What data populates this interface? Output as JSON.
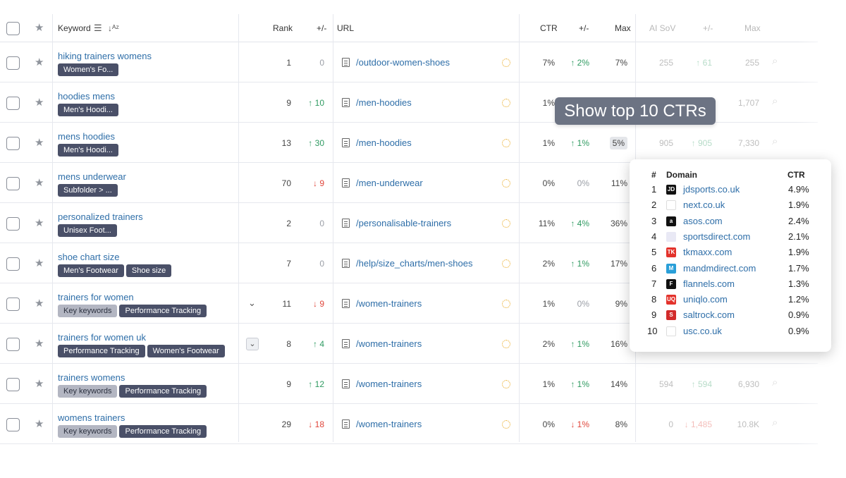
{
  "header": {
    "keyword": "Keyword",
    "rank": "Rank",
    "rank_delta": "+/-",
    "url": "URL",
    "ctr": "CTR",
    "ctr_delta": "+/-",
    "max": "Max",
    "ai_sov": "AI SoV",
    "ai_delta": "+/-",
    "ai_max": "Max"
  },
  "rows": [
    {
      "keyword": "hiking trainers womens",
      "tags": [
        {
          "t": "Women's Fo...",
          "s": "dark"
        }
      ],
      "rank": "1",
      "rank_delta": "0",
      "rank_dir": "zero",
      "url": "/outdoor-women-shoes",
      "ctr": "7%",
      "ctr_delta": "2%",
      "ctr_dir": "up",
      "max": "7%",
      "ai": "255",
      "ai_delta": "61",
      "ai_max": "255"
    },
    {
      "keyword": "hoodies mens",
      "tags": [
        {
          "t": "Men's Hoodi...",
          "s": "dark"
        }
      ],
      "rank": "9",
      "rank_delta": "10",
      "rank_dir": "up",
      "url": "/men-hoodies",
      "ctr": "1%",
      "ctr_delta": "",
      "ctr_dir": "none",
      "max": "",
      "ai": "",
      "ai_delta": "",
      "ai_max": "1,707"
    },
    {
      "keyword": "mens hoodies",
      "tags": [
        {
          "t": "Men's Hoodi...",
          "s": "dark"
        }
      ],
      "rank": "13",
      "rank_delta": "30",
      "rank_dir": "up",
      "url": "/men-hoodies",
      "ctr": "1%",
      "ctr_delta": "1%",
      "ctr_dir": "up",
      "max": "5%",
      "ai": "905",
      "ai_delta": "905",
      "ai_max": "7,330"
    },
    {
      "keyword": "mens underwear",
      "tags": [
        {
          "t": "Subfolder > ...",
          "s": "dark"
        }
      ],
      "rank": "70",
      "rank_delta": "9",
      "rank_dir": "down",
      "url": "/men-underwear",
      "ctr": "0%",
      "ctr_delta": "0%",
      "ctr_dir": "zero",
      "max": "11%",
      "ai": "",
      "ai_delta": "",
      "ai_max": ""
    },
    {
      "keyword": "personalized trainers",
      "tags": [
        {
          "t": "Unisex Foot...",
          "s": "dark"
        }
      ],
      "rank": "2",
      "rank_delta": "0",
      "rank_dir": "zero",
      "url": "/personalisable-trainers",
      "ctr": "11%",
      "ctr_delta": "4%",
      "ctr_dir": "up",
      "max": "36%",
      "ai": "",
      "ai_delta": "",
      "ai_max": ""
    },
    {
      "keyword": "shoe chart size",
      "tags": [
        {
          "t": "Men's Footwear",
          "s": "dark"
        },
        {
          "t": "Shoe size",
          "s": "dark"
        }
      ],
      "rank": "7",
      "rank_delta": "0",
      "rank_dir": "zero",
      "url": "/help/size_charts/men-shoes",
      "ctr": "2%",
      "ctr_delta": "1%",
      "ctr_dir": "up",
      "max": "17%",
      "ai": "",
      "ai_delta": "",
      "ai_max": ""
    },
    {
      "keyword": "trainers for women",
      "tags": [
        {
          "t": "Key keywords",
          "s": "light"
        },
        {
          "t": "Performance Tracking",
          "s": "dark"
        }
      ],
      "rank": "11",
      "rank_delta": "9",
      "rank_dir": "down",
      "url": "/women-trainers",
      "ctr": "1%",
      "ctr_delta": "0%",
      "ctr_dir": "zero",
      "max": "9%",
      "ai": "",
      "ai_delta": "",
      "ai_max": ""
    },
    {
      "keyword": "trainers for women uk",
      "tags": [
        {
          "t": "Performance Tracking",
          "s": "dark"
        },
        {
          "t": "Women's Footwear",
          "s": "dark"
        }
      ],
      "rank": "8",
      "rank_delta": "4",
      "rank_dir": "up",
      "url": "/women-trainers",
      "ctr": "2%",
      "ctr_delta": "1%",
      "ctr_dir": "up",
      "max": "16%",
      "ai": "",
      "ai_delta": "",
      "ai_max": ""
    },
    {
      "keyword": "trainers womens",
      "tags": [
        {
          "t": "Key keywords",
          "s": "light"
        },
        {
          "t": "Performance Tracking",
          "s": "dark"
        }
      ],
      "rank": "9",
      "rank_delta": "12",
      "rank_dir": "up",
      "url": "/women-trainers",
      "ctr": "1%",
      "ctr_delta": "1%",
      "ctr_dir": "up",
      "max": "14%",
      "ai": "594",
      "ai_delta": "594",
      "ai_max": "6,930"
    },
    {
      "keyword": "womens trainers",
      "tags": [
        {
          "t": "Key keywords",
          "s": "light"
        },
        {
          "t": "Performance Tracking",
          "s": "dark"
        }
      ],
      "rank": "29",
      "rank_delta": "18",
      "rank_dir": "down",
      "url": "/women-trainers",
      "ctr": "0%",
      "ctr_delta": "1%",
      "ctr_dir": "down",
      "max": "8%",
      "ai": "0",
      "ai_delta": "1,485",
      "ai_max": "10.8K"
    }
  ],
  "tooltip": "Show top 10 CTRs",
  "popup": {
    "col_rank": "#",
    "col_domain": "Domain",
    "col_ctr": "CTR",
    "items": [
      {
        "n": "1",
        "domain": "jdsports.co.uk",
        "ctr": "4.9%",
        "icon": "jd-icon",
        "color": "#111111",
        "glyph": "JD"
      },
      {
        "n": "2",
        "domain": "next.co.uk",
        "ctr": "1.9%",
        "icon": "next-icon",
        "color": "#ffffff",
        "glyph": "next"
      },
      {
        "n": "3",
        "domain": "asos.com",
        "ctr": "2.4%",
        "icon": "asos-icon",
        "color": "#111111",
        "glyph": "a"
      },
      {
        "n": "4",
        "domain": "sportsdirect.com",
        "ctr": "2.1%",
        "icon": "sportsdirect-icon",
        "color": "#e9e9f5",
        "glyph": ""
      },
      {
        "n": "5",
        "domain": "tkmaxx.com",
        "ctr": "1.9%",
        "icon": "tkmaxx-icon",
        "color": "#e3322b",
        "glyph": "TK"
      },
      {
        "n": "6",
        "domain": "mandmdirect.com",
        "ctr": "1.7%",
        "icon": "mandm-icon",
        "color": "#2a9fd8",
        "glyph": "M"
      },
      {
        "n": "7",
        "domain": "flannels.com",
        "ctr": "1.3%",
        "icon": "flannels-icon",
        "color": "#111111",
        "glyph": "F"
      },
      {
        "n": "8",
        "domain": "uniqlo.com",
        "ctr": "1.2%",
        "icon": "uniqlo-icon",
        "color": "#e3322b",
        "glyph": "UQ"
      },
      {
        "n": "9",
        "domain": "saltrock.com",
        "ctr": "0.9%",
        "icon": "saltrock-icon",
        "color": "#d22b2b",
        "glyph": "S"
      },
      {
        "n": "10",
        "domain": "usc.co.uk",
        "ctr": "0.9%",
        "icon": "usc-icon",
        "color": "#ffffff",
        "glyph": "usc"
      }
    ]
  }
}
